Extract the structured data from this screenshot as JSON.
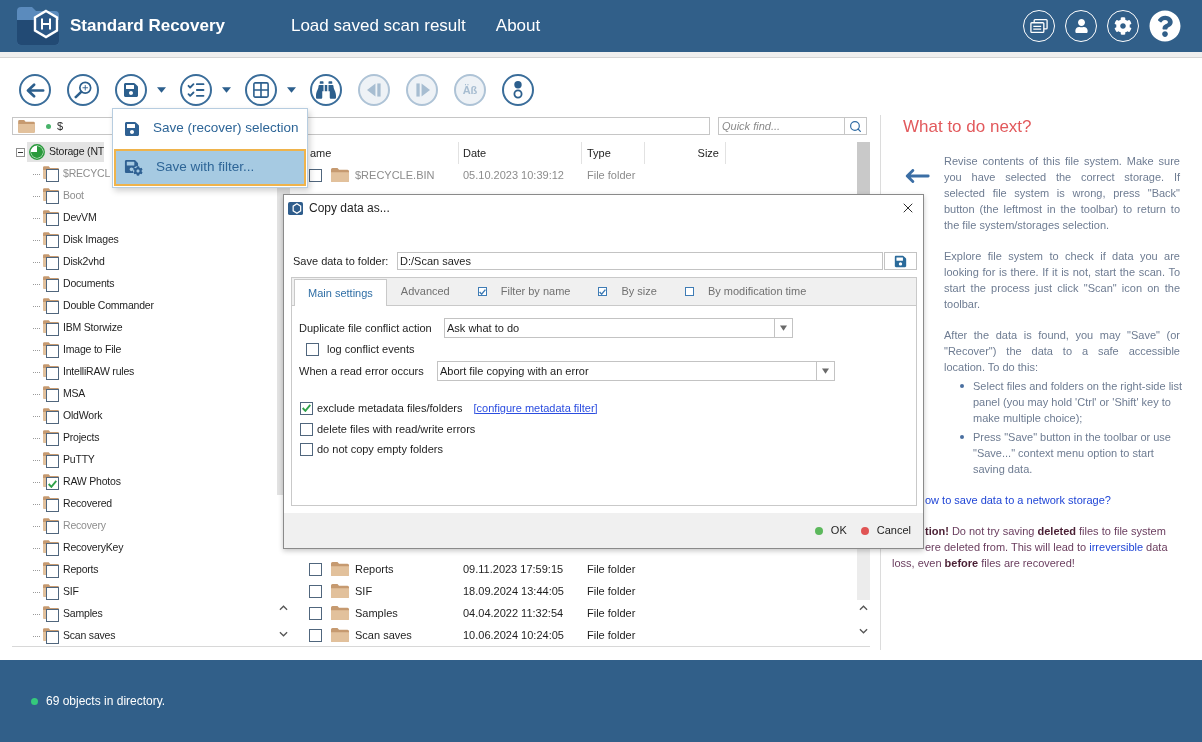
{
  "header": {
    "app_name": "Standard Recovery",
    "nav": [
      {
        "label": "Load saved scan result"
      },
      {
        "label": "About"
      }
    ]
  },
  "toolbar": [
    {
      "disabled": false,
      "dropdown": false
    },
    {
      "disabled": false,
      "dropdown": false
    },
    {
      "disabled": false,
      "dropdown": true
    },
    {
      "disabled": false,
      "dropdown": true
    },
    {
      "disabled": false,
      "dropdown": true
    },
    {
      "disabled": false,
      "dropdown": false
    },
    {
      "disabled": true,
      "dropdown": false
    },
    {
      "disabled": true,
      "dropdown": false
    },
    {
      "disabled": true,
      "dropdown": false,
      "label": "Äß"
    },
    {
      "disabled": false,
      "dropdown": false
    }
  ],
  "save_menu": [
    {
      "label": "Save (recover) selection",
      "selected": false
    },
    {
      "label": "Save with filter...",
      "selected": true
    }
  ],
  "path_bar": {
    "path": "$",
    "quick_find": {
      "placeholder": "Quick find..."
    }
  },
  "tree": {
    "label": "Storage (NT",
    "selected": true,
    "expanded": true,
    "children": [
      {
        "label": "$RECYCL",
        "checked": false,
        "greyed": true
      },
      {
        "label": "Boot",
        "checked": false,
        "greyed": true
      },
      {
        "label": "DevVM",
        "checked": false,
        "greyed": false
      },
      {
        "label": "Disk Images",
        "checked": false,
        "greyed": false
      },
      {
        "label": "Disk2vhd",
        "checked": false,
        "greyed": false
      },
      {
        "label": "Documents",
        "checked": false,
        "greyed": false
      },
      {
        "label": "Double Commander",
        "checked": false,
        "greyed": false
      },
      {
        "label": "IBM Storwize",
        "checked": false,
        "greyed": false
      },
      {
        "label": "Image to File",
        "checked": false,
        "greyed": false
      },
      {
        "label": "IntelliRAW rules",
        "checked": false,
        "greyed": false
      },
      {
        "label": "MSA",
        "checked": false,
        "greyed": false
      },
      {
        "label": "OldWork",
        "checked": false,
        "greyed": false
      },
      {
        "label": "Projects",
        "checked": false,
        "greyed": false
      },
      {
        "label": "PuTTY",
        "checked": false,
        "greyed": false
      },
      {
        "label": "RAW Photos",
        "checked": true,
        "greyed": false
      },
      {
        "label": "Recovered",
        "checked": false,
        "greyed": false
      },
      {
        "label": "Recovery",
        "checked": false,
        "greyed": true
      },
      {
        "label": "RecoveryKey",
        "checked": false,
        "greyed": false
      },
      {
        "label": "Reports",
        "checked": false,
        "greyed": false
      },
      {
        "label": "SIF",
        "checked": false,
        "greyed": false
      },
      {
        "label": "Samples",
        "checked": false,
        "greyed": false
      },
      {
        "label": "Scan saves",
        "checked": false,
        "greyed": false
      }
    ]
  },
  "file_list": {
    "columns": [
      "ame",
      "Date",
      "Type",
      "Size"
    ],
    "rows_top": [
      {
        "name": "$RECYCLE.BIN",
        "date": "05.10.2023 10:39:12",
        "type": "File folder",
        "checked": false,
        "greyed": true
      }
    ],
    "rows_bottom": [
      {
        "name": "Reports",
        "date": "09.11.2023 17:59:15",
        "type": "File folder",
        "checked": false,
        "greyed": false
      },
      {
        "name": "SIF",
        "date": "18.09.2024 13:44:05",
        "type": "File folder",
        "checked": false,
        "greyed": false
      },
      {
        "name": "Samples",
        "date": "04.04.2022 11:32:54",
        "type": "File folder",
        "checked": false,
        "greyed": false
      },
      {
        "name": "Scan saves",
        "date": "10.06.2024 10:24:05",
        "type": "File folder",
        "checked": false,
        "greyed": false
      }
    ]
  },
  "dialog": {
    "title": "Copy data as...",
    "folder_label": "Save data to folder:",
    "folder_path": "D:/Scan saves",
    "tabs": [
      {
        "label": "Main settings",
        "kind": "plain",
        "selected": true
      },
      {
        "label": "Advanced",
        "kind": "plain",
        "selected": false
      },
      {
        "label": "Filter by name",
        "kind": "checkbox",
        "checked": true,
        "selected": false
      },
      {
        "label": "By size",
        "kind": "checkbox",
        "checked": true,
        "selected": false
      },
      {
        "label": "By modification time",
        "kind": "checkbox",
        "checked": false,
        "selected": false
      }
    ],
    "fields": [
      {
        "kind": "select",
        "label": "Duplicate file conflict action",
        "value": "Ask what to do"
      },
      {
        "kind": "checkbox",
        "label": "log conflict events",
        "checked": false
      },
      {
        "kind": "select",
        "label": "When a read error occurs",
        "value": "Abort file copying with an error"
      },
      {
        "kind": "checkbox",
        "label": "exclude metadata files/folders",
        "checked": true,
        "link": "[configure metadata filter]"
      },
      {
        "kind": "checkbox",
        "label": "delete files with read/write errors",
        "checked": false
      },
      {
        "kind": "checkbox",
        "label": "do not copy empty folders",
        "checked": false
      }
    ],
    "buttons": [
      {
        "label": "OK",
        "color": "#5cb85c"
      },
      {
        "label": "Cancel",
        "color": "#e05454"
      }
    ]
  },
  "help_panel": {
    "title": "What to do next?",
    "paragraphs": [
      "Revise contents of this file system. Make sure you have selected the correct storage. If selected file system is wrong, press \"Back\" button (the leftmost in the toolbar) to return to the file system/storages selection.",
      "Explore file system to check if data you are looking for is there. If it is not, start the scan. To start the process just click \"Scan\" icon on the toolbar.",
      "After the data is found, you may \"Save\" (or \"Recover\") the data to a safe accessible location. To do this:"
    ],
    "steps": [
      "Select files and folders on the right-side list panel (you may hold 'Ctrl' or 'Shift' key to make multiple choice);",
      "Press \"Save\" button in the toolbar or use \"Save...\" context menu option to start saving data."
    ],
    "link": "ow to save data to a network storage?",
    "caution_lines": [
      [
        {
          "kind": "text",
          "text": "**tion!** Do not try saving **deleted** files to file system"
        }
      ],
      [
        {
          "kind": "text",
          "text": "ere deleted from. This will lead to "
        },
        {
          "kind": "link",
          "text": "irreversible"
        },
        {
          "kind": "text",
          "text": " data"
        }
      ],
      [
        {
          "kind": "text",
          "text": "loss, even **before** files are recovered!"
        }
      ]
    ]
  },
  "status_bar": {
    "text": "69 objects in directory."
  }
}
